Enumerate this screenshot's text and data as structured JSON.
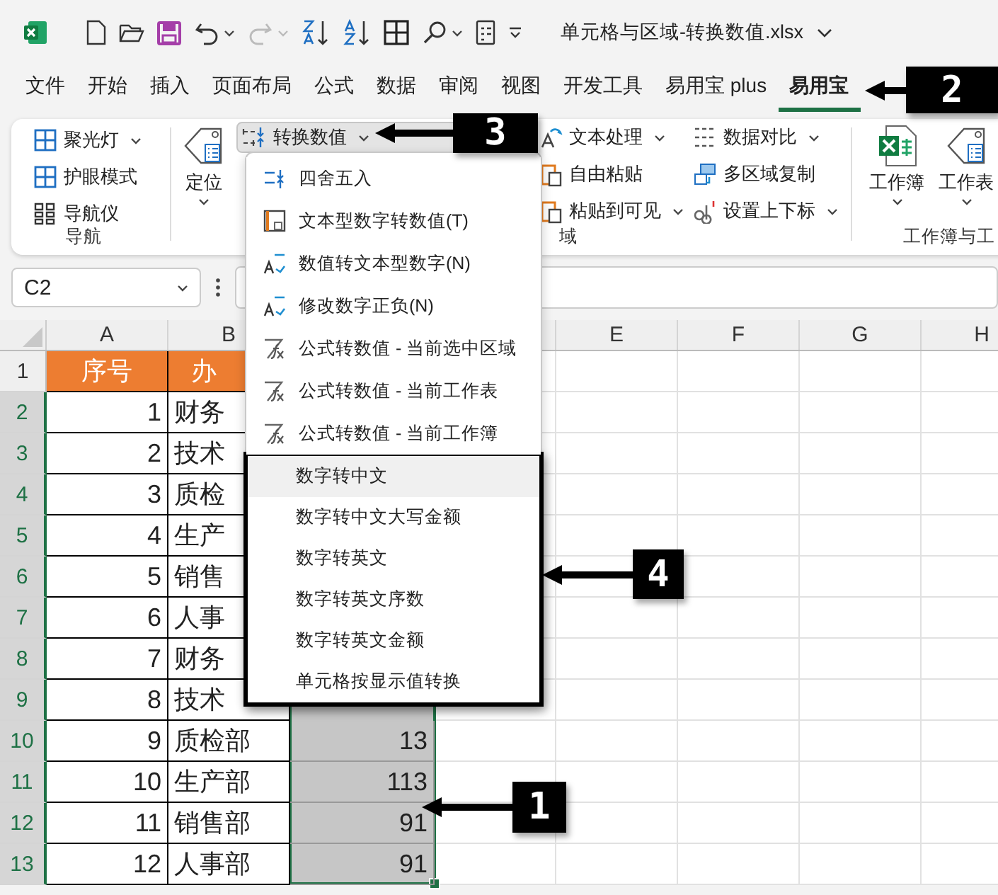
{
  "title_bar": {
    "title": "单元格与区域-转换数值.xlsx"
  },
  "menu_tabs": [
    {
      "label": "文件",
      "selected": false
    },
    {
      "label": "开始",
      "selected": false
    },
    {
      "label": "插入",
      "selected": false
    },
    {
      "label": "页面布局",
      "selected": false
    },
    {
      "label": "公式",
      "selected": false
    },
    {
      "label": "数据",
      "selected": false
    },
    {
      "label": "审阅",
      "selected": false
    },
    {
      "label": "视图",
      "selected": false
    },
    {
      "label": "开发工具",
      "selected": false
    },
    {
      "label": "易用宝 plus",
      "selected": false
    },
    {
      "label": "易用宝",
      "selected": true
    }
  ],
  "ribbon": {
    "groups": [
      {
        "kind": "small-list",
        "label": "导航",
        "items": [
          {
            "label": "聚光灯",
            "dropdown": true
          },
          {
            "label": "护眼模式",
            "dropdown": false
          },
          {
            "label": "导航仪",
            "dropdown": false
          }
        ]
      },
      {
        "kind": "large",
        "items": [
          {
            "label": "定位",
            "dropdown": true
          }
        ]
      },
      {
        "kind": "tools",
        "label": "域",
        "items": [
          {
            "label": "转换数值",
            "dropdown": true,
            "pressed": true
          }
        ],
        "columns": [
          [
            {
              "label": "文本处理",
              "dropdown": true
            },
            {
              "label": "自由粘贴",
              "dropdown": false
            },
            {
              "label": "粘贴到可见",
              "dropdown": true
            }
          ],
          [
            {
              "label": "数据对比",
              "dropdown": true
            },
            {
              "label": "多区域复制",
              "dropdown": false
            },
            {
              "label": "设置上下标",
              "dropdown": true
            }
          ]
        ]
      },
      {
        "kind": "large",
        "label": "工作簿与工",
        "items": [
          {
            "label": "工作簿",
            "dropdown": true
          },
          {
            "label": "工作表",
            "dropdown": true
          }
        ]
      }
    ]
  },
  "formula_bar": {
    "name_box": "C2"
  },
  "sheet": {
    "columns": [
      "A",
      "B",
      null,
      null,
      "E",
      "F",
      "G",
      "H"
    ],
    "rows": [
      {
        "number": "1",
        "kind": "header",
        "selected": false,
        "a": "序号",
        "b": "办"
      },
      {
        "number": "2",
        "kind": "data",
        "selected": true,
        "a": "1",
        "b": "财务"
      },
      {
        "number": "3",
        "kind": "data",
        "selected": true,
        "a": "2",
        "b": "技术"
      },
      {
        "number": "4",
        "kind": "data",
        "selected": true,
        "a": "3",
        "b": "质检"
      },
      {
        "number": "5",
        "kind": "data",
        "selected": true,
        "a": "4",
        "b": "生产"
      },
      {
        "number": "6",
        "kind": "data",
        "selected": true,
        "a": "5",
        "b": "销售"
      },
      {
        "number": "7",
        "kind": "data",
        "selected": true,
        "a": "6",
        "b": "人事"
      },
      {
        "number": "8",
        "kind": "data",
        "selected": true,
        "a": "7",
        "b": "财务"
      },
      {
        "number": "9",
        "kind": "data",
        "selected": true,
        "a": "8",
        "b": "技术"
      },
      {
        "number": "10",
        "kind": "data",
        "selected": true,
        "a": "9",
        "b": "质检部",
        "c": "13"
      },
      {
        "number": "11",
        "kind": "data",
        "selected": true,
        "a": "10",
        "b": "生产部",
        "c": "113"
      },
      {
        "number": "12",
        "kind": "data",
        "selected": true,
        "a": "11",
        "b": "销售部",
        "c": "91"
      },
      {
        "number": "13",
        "kind": "data",
        "selected": true,
        "a": "12",
        "b": "人事部",
        "c": "91"
      }
    ]
  },
  "dropdown_menu": {
    "groups": [
      {
        "boxed": false,
        "items": [
          {
            "label": "四舍五入",
            "kind": "round",
            "highlighted": false
          },
          {
            "label": "文本型数字转数值(T)",
            "kind": "text-to-number",
            "highlighted": false
          },
          {
            "label": "数值转文本型数字(N)",
            "kind": "number-to-text",
            "highlighted": false
          },
          {
            "label": "修改数字正负(N)",
            "kind": "number-to-text",
            "highlighted": false
          },
          {
            "label": "公式转数值 - 当前选中区域",
            "kind": "formula",
            "highlighted": false
          },
          {
            "label": "公式转数值 - 当前工作表",
            "kind": "formula",
            "highlighted": false
          },
          {
            "label": "公式转数值 - 当前工作簿",
            "kind": "formula",
            "highlighted": false
          }
        ]
      },
      {
        "boxed": true,
        "items": [
          {
            "label": "数字转中文",
            "kind": "plain",
            "highlighted": true
          },
          {
            "label": "数字转中文大写金额",
            "kind": "plain",
            "highlighted": false
          },
          {
            "label": "数字转英文",
            "kind": "plain",
            "highlighted": false
          },
          {
            "label": "数字转英文序数",
            "kind": "plain",
            "highlighted": false
          },
          {
            "label": "数字转英文金额",
            "kind": "plain",
            "highlighted": false
          },
          {
            "label": "单元格按显示值转换",
            "kind": "plain",
            "highlighted": false
          }
        ]
      }
    ]
  },
  "annotations": [
    {
      "label": "2"
    },
    {
      "label": "3"
    },
    {
      "label": "4"
    },
    {
      "label": "1"
    }
  ]
}
